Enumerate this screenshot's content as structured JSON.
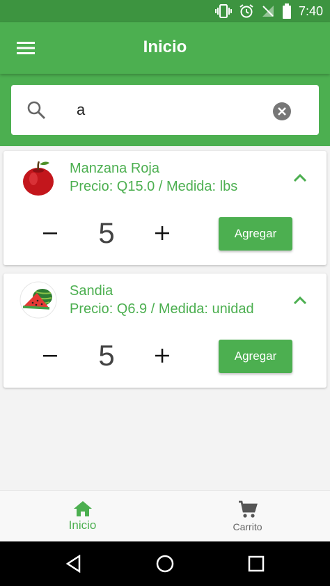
{
  "status_bar": {
    "time": "7:40"
  },
  "app_bar": {
    "title": "Inicio"
  },
  "search": {
    "value": "a",
    "placeholder": ""
  },
  "products": [
    {
      "name": "Manzana Roja",
      "info": "Precio: Q15.0 / Medida: lbs",
      "quantity": "5",
      "add_label": "Agregar",
      "minus": "−",
      "plus": "+"
    },
    {
      "name": "Sandia",
      "info": "Precio: Q6.9 / Medida: unidad",
      "quantity": "5",
      "add_label": "Agregar",
      "minus": "−",
      "plus": "+"
    }
  ],
  "bottom_nav": {
    "inicio_label": "Inicio",
    "carrito_label": "Carrito"
  },
  "colors": {
    "primary": "#4caf50",
    "primary_dark": "#3d9440",
    "icon_gray": "#555555"
  },
  "icons": [
    "vibrate-icon",
    "alarm-icon",
    "no-signal-icon",
    "battery-icon",
    "menu-icon",
    "search-icon",
    "clear-icon",
    "apple-image",
    "watermelon-image",
    "chevron-up-icon",
    "home-icon",
    "cart-icon",
    "back-icon",
    "home-circle-icon",
    "recents-icon"
  ]
}
